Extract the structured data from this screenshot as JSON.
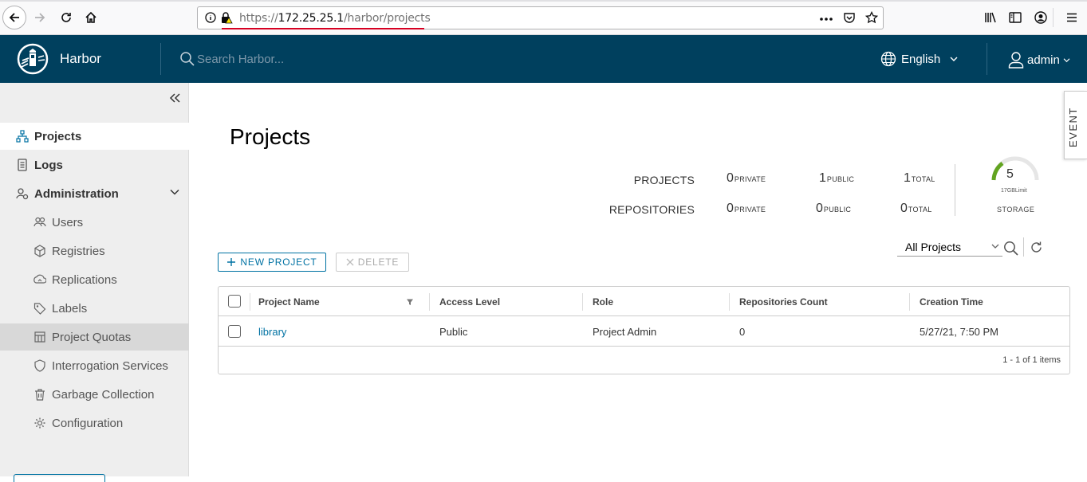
{
  "browser": {
    "url_prefix": "https://",
    "url_host": "172.25.25.1",
    "url_path": "/harbor/projects"
  },
  "header": {
    "brand": "Harbor",
    "search_placeholder": "Search Harbor...",
    "language": "English",
    "user": "admin"
  },
  "sidebar": {
    "items": [
      {
        "label": "Projects"
      },
      {
        "label": "Logs"
      },
      {
        "label": "Administration"
      },
      {
        "label": "Users"
      },
      {
        "label": "Registries"
      },
      {
        "label": "Replications"
      },
      {
        "label": "Labels"
      },
      {
        "label": "Project Quotas"
      },
      {
        "label": "Interrogation Services"
      },
      {
        "label": "Garbage Collection"
      },
      {
        "label": "Configuration"
      }
    ]
  },
  "main": {
    "title": "Projects",
    "stats": {
      "projects_label": "PROJECTS",
      "repositories_label": "REPOSITORIES",
      "projects_private": "0",
      "projects_public": "1",
      "projects_total": "1",
      "repos_private": "0",
      "repos_public": "0",
      "repos_total": "0",
      "private_label": "PRIVATE",
      "public_label": "PUBLIC",
      "total_label": "TOTAL",
      "storage_value": "5",
      "storage_limit": "17GBLimit",
      "storage_label": "STORAGE"
    },
    "new_project_label": "NEW PROJECT",
    "delete_label": "DELETE",
    "filter_value": "All Projects",
    "event_tab": "EVENT",
    "table": {
      "columns": [
        "Project Name",
        "Access Level",
        "Role",
        "Repositories Count",
        "Creation Time"
      ],
      "rows": [
        {
          "name": "library",
          "access": "Public",
          "role": "Project Admin",
          "repos": "0",
          "created": "5/27/21, 7:50 PM"
        }
      ],
      "footer": "1 - 1 of 1 items"
    }
  },
  "colors": {
    "header_bg": "#00405e",
    "accent": "#0072a3",
    "gauge_green": "#62a420"
  }
}
